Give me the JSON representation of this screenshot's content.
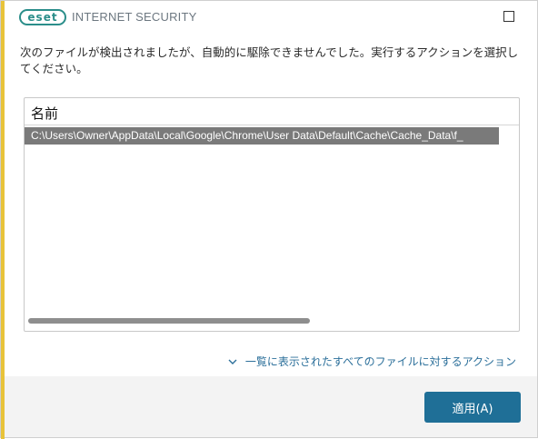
{
  "window": {
    "logo_text": "eset",
    "title": "INTERNET SECURITY"
  },
  "message": "次のファイルが検出されましたが、自動的に駆除できませんでした。実行するアクションを選択してください。",
  "list": {
    "header": "名前",
    "rows": [
      "C:\\Users\\Owner\\AppData\\Local\\Google\\Chrome\\User Data\\Default\\Cache\\Cache_Data\\f_"
    ]
  },
  "actions_link": "一覧に表示されたすべてのファイルに対するアクション",
  "apply_button": "適用(A)",
  "colors": {
    "accent_bar": "#e8c33a",
    "brand": "#2b8e8a",
    "link": "#2b6f9a",
    "primary_button": "#1f6f97",
    "selected_row": "#7a7a7a"
  }
}
